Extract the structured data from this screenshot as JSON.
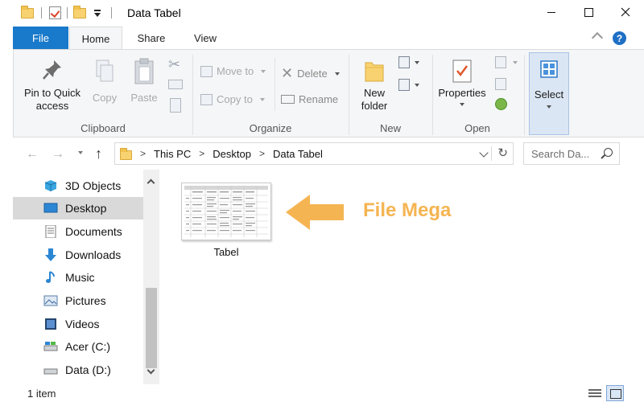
{
  "window": {
    "title": "Data Tabel"
  },
  "tabs": {
    "file": "File",
    "home": "Home",
    "share": "Share",
    "view": "View"
  },
  "ribbon": {
    "clipboard": {
      "label": "Clipboard",
      "pin": "Pin to Quick access",
      "copy": "Copy",
      "paste": "Paste"
    },
    "organize": {
      "label": "Organize",
      "move_to": "Move to",
      "copy_to": "Copy to",
      "delete": "Delete",
      "rename": "Rename"
    },
    "new": {
      "label": "New",
      "new_folder": "New folder"
    },
    "open": {
      "label": "Open",
      "properties": "Properties"
    },
    "select": {
      "label": "Select"
    }
  },
  "address": {
    "crumbs": [
      "This PC",
      "Desktop",
      "Data Tabel"
    ],
    "search_placeholder": "Search Da..."
  },
  "nav_items": [
    {
      "label": "3D Objects",
      "icon": "cube-icon",
      "selected": false
    },
    {
      "label": "Desktop",
      "icon": "desktop-icon",
      "selected": true
    },
    {
      "label": "Documents",
      "icon": "documents-icon",
      "selected": false
    },
    {
      "label": "Downloads",
      "icon": "downloads-icon",
      "selected": false
    },
    {
      "label": "Music",
      "icon": "music-icon",
      "selected": false
    },
    {
      "label": "Pictures",
      "icon": "pictures-icon",
      "selected": false
    },
    {
      "label": "Videos",
      "icon": "videos-icon",
      "selected": false
    },
    {
      "label": "Acer (C:)",
      "icon": "drive-c-icon",
      "selected": false
    },
    {
      "label": "Data (D:)",
      "icon": "drive-d-icon",
      "selected": false
    }
  ],
  "content": {
    "file_name": "Tabel",
    "annotation": "File Mega"
  },
  "status": {
    "item_count": "1 item"
  },
  "colors": {
    "file_tab": "#1979ca",
    "annotation": "#f5b452",
    "selected_nav": "#d9d9d9",
    "folder": "#f8d270"
  }
}
